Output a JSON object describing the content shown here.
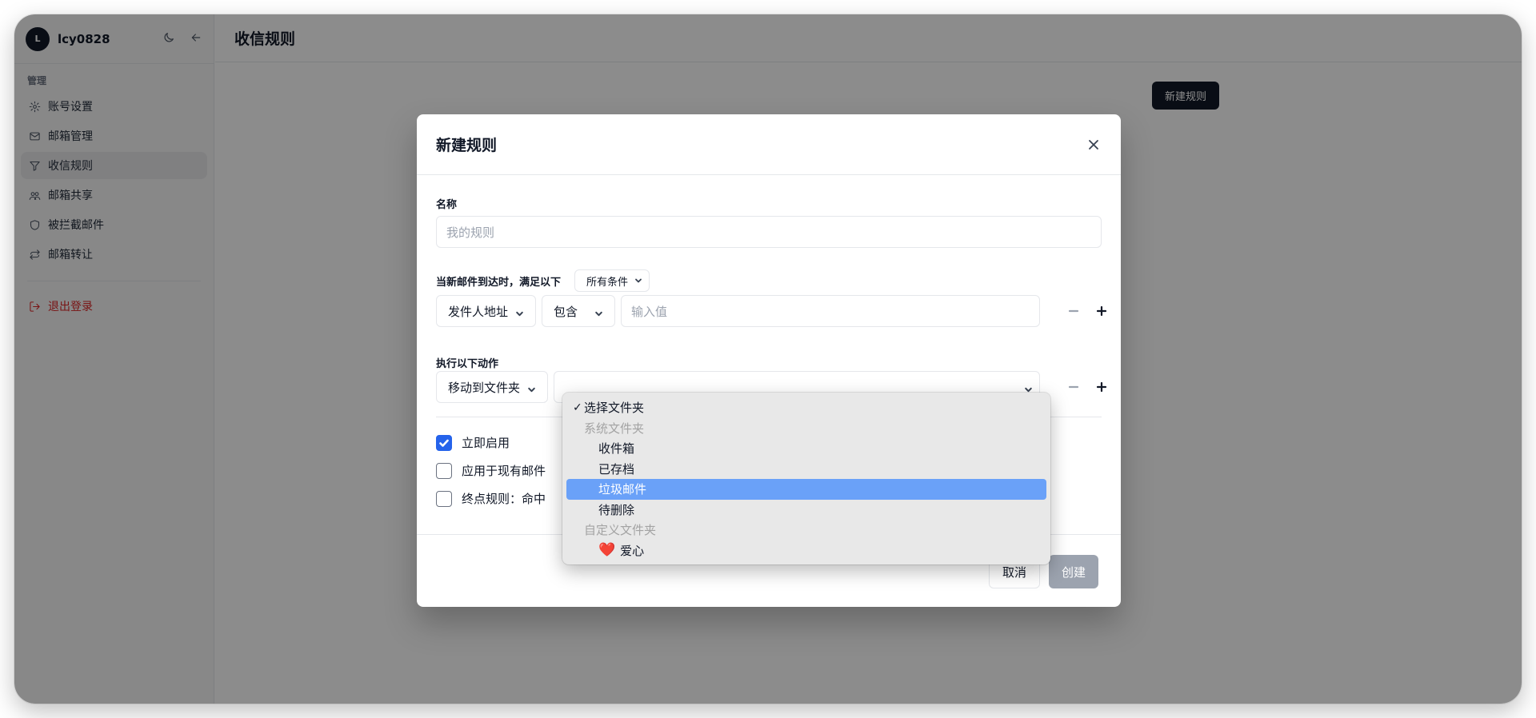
{
  "user": {
    "initial": "L",
    "name": "lcy0828"
  },
  "sidebar": {
    "group_label": "管理",
    "items": [
      {
        "label": "账号设置",
        "icon": "gear-icon"
      },
      {
        "label": "邮箱管理",
        "icon": "mail-icon"
      },
      {
        "label": "收信规则",
        "icon": "filter-icon",
        "active": true
      },
      {
        "label": "邮箱共享",
        "icon": "users-icon"
      },
      {
        "label": "被拦截邮件",
        "icon": "shield-icon"
      },
      {
        "label": "邮箱转让",
        "icon": "transfer-icon"
      }
    ],
    "logout": "退出登录"
  },
  "main": {
    "title": "收信规则",
    "new_rule_button": "新建规则"
  },
  "modal": {
    "title": "新建规则",
    "name_label": "名称",
    "name_placeholder": "我的规则",
    "condition_label": "当新邮件到达时，满足以下",
    "match_mode": "所有条件",
    "condition": {
      "field": "发件人地址",
      "operator": "包含",
      "value_placeholder": "输入值"
    },
    "action_label": "执行以下动作",
    "action": {
      "type": "移动到文件夹"
    },
    "checkboxes": [
      {
        "label": "立即启用",
        "checked": true
      },
      {
        "label": "应用于现有邮件",
        "checked": false
      },
      {
        "label": "终点规则：命中",
        "checked": false
      }
    ],
    "cancel": "取消",
    "create": "创建"
  },
  "dropdown": {
    "selected": "选择文件夹",
    "groups": [
      {
        "label": "系统文件夹",
        "options": [
          "收件箱",
          "已存档",
          "垃圾邮件",
          "待删除"
        ]
      },
      {
        "label": "自定义文件夹",
        "options": [
          "爱心"
        ]
      }
    ],
    "highlighted": "垃圾邮件",
    "custom_icon": "❤️"
  },
  "colors": {
    "primary": "#111827",
    "checkbox_checked": "#2563eb",
    "highlight": "#6aa1f8",
    "danger": "#dc2626"
  }
}
